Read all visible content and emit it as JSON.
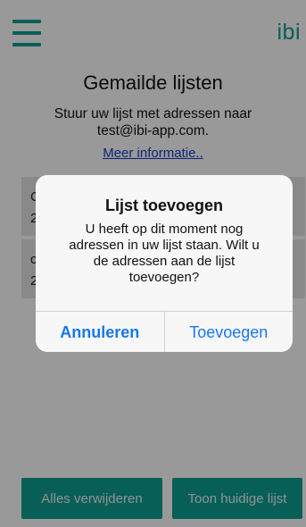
{
  "header": {
    "menu_icon": "hamburger-menu-icon",
    "brand": "ibi",
    "accent_color": "#0e9e92"
  },
  "main": {
    "title": "Gemailde lijsten",
    "subtitle_line1": "Stuur uw lijst met adressen naar",
    "subtitle_line2": "test@ibi-app.com.",
    "more_info": "Meer informatie.."
  },
  "list": {
    "items": [
      {
        "line1": "C",
        "line2": "2"
      },
      {
        "line1": "c",
        "line2": "2"
      }
    ]
  },
  "footer": {
    "clear_all": "Alles verwijderen",
    "show_current": "Toon huidige lijst"
  },
  "dialog": {
    "title": "Lijst toevoegen",
    "message_line1": "U heeft op dit moment nog",
    "message_line2": "adressen in uw lijst staan. Wilt u",
    "message_line3": "de adressen aan de lijst",
    "message_line4": "toevoegen?",
    "cancel": "Annuleren",
    "confirm": "Toevoegen",
    "button_color": "#1877f2"
  }
}
